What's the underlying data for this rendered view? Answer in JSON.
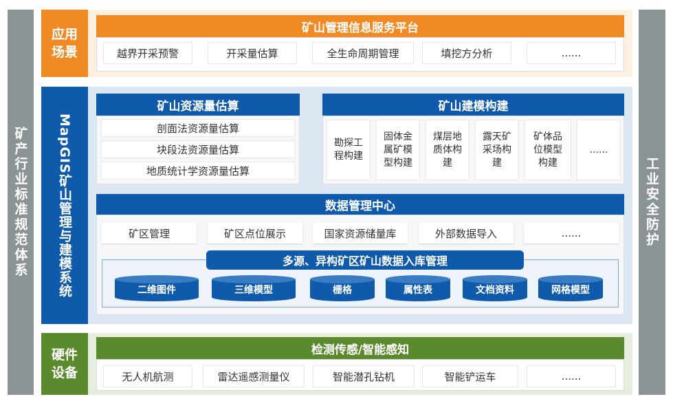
{
  "side_left": "矿产行业标准规范体系",
  "side_right": "工业安全防护",
  "app_layer": {
    "label": "应用场景",
    "title": "矿山管理信息服务平台",
    "items": [
      "越界开采预警",
      "开采量估算",
      "全生命周期管理",
      "填挖方分析",
      "......"
    ]
  },
  "system_layer": {
    "label": "MapGIS矿山管理与建模系统",
    "estimation": {
      "title": "矿山资源量估算",
      "items": [
        "剖面法资源量估算",
        "块段法资源量估算",
        "地质统计学资源量估算"
      ]
    },
    "modeling": {
      "title": "矿山建模构建",
      "items": [
        "勘探工程构建",
        "固体金属矿模型构建",
        "煤层地质体构建",
        "露天矿采场构建",
        "矿体品位模型构建",
        "......"
      ]
    },
    "data_center": {
      "title": "数据管理中心",
      "items": [
        "矿区管理",
        "矿区点位展示",
        "国家资源储量库",
        "外部数据导入",
        "......"
      ],
      "ingest_title": "多源、异构矿区矿山数据入库管理",
      "stores": [
        "二维图件",
        "三维模型",
        "栅格",
        "属性表",
        "文档资料",
        "网格模型"
      ]
    }
  },
  "hardware_layer": {
    "label": "硬件设备",
    "title": "检测传感/智能感知",
    "items": [
      "无人机航测",
      "雷达遥感测量仪",
      "智能潜孔钻机",
      "智能铲运车",
      "......"
    ]
  },
  "colors": {
    "orange": "#f08a24",
    "blue": "#0f5aaa",
    "green": "#5b8a2e",
    "gray": "#8c9396"
  }
}
